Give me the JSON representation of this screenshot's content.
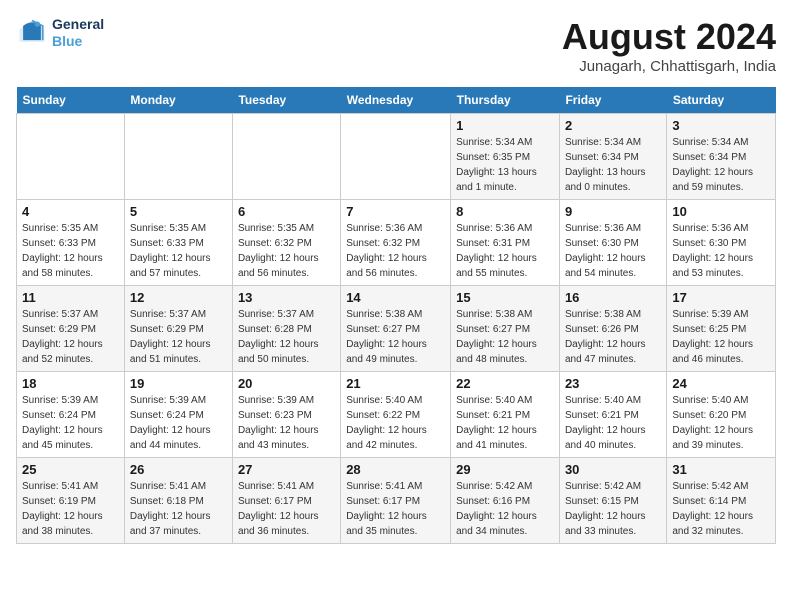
{
  "logo": {
    "line1": "General",
    "line2": "Blue"
  },
  "title": "August 2024",
  "subtitle": "Junagarh, Chhattisgarh, India",
  "days_of_week": [
    "Sunday",
    "Monday",
    "Tuesday",
    "Wednesday",
    "Thursday",
    "Friday",
    "Saturday"
  ],
  "weeks": [
    [
      {
        "day": "",
        "info": ""
      },
      {
        "day": "",
        "info": ""
      },
      {
        "day": "",
        "info": ""
      },
      {
        "day": "",
        "info": ""
      },
      {
        "day": "1",
        "info": "Sunrise: 5:34 AM\nSunset: 6:35 PM\nDaylight: 13 hours\nand 1 minute."
      },
      {
        "day": "2",
        "info": "Sunrise: 5:34 AM\nSunset: 6:34 PM\nDaylight: 13 hours\nand 0 minutes."
      },
      {
        "day": "3",
        "info": "Sunrise: 5:34 AM\nSunset: 6:34 PM\nDaylight: 12 hours\nand 59 minutes."
      }
    ],
    [
      {
        "day": "4",
        "info": "Sunrise: 5:35 AM\nSunset: 6:33 PM\nDaylight: 12 hours\nand 58 minutes."
      },
      {
        "day": "5",
        "info": "Sunrise: 5:35 AM\nSunset: 6:33 PM\nDaylight: 12 hours\nand 57 minutes."
      },
      {
        "day": "6",
        "info": "Sunrise: 5:35 AM\nSunset: 6:32 PM\nDaylight: 12 hours\nand 56 minutes."
      },
      {
        "day": "7",
        "info": "Sunrise: 5:36 AM\nSunset: 6:32 PM\nDaylight: 12 hours\nand 56 minutes."
      },
      {
        "day": "8",
        "info": "Sunrise: 5:36 AM\nSunset: 6:31 PM\nDaylight: 12 hours\nand 55 minutes."
      },
      {
        "day": "9",
        "info": "Sunrise: 5:36 AM\nSunset: 6:30 PM\nDaylight: 12 hours\nand 54 minutes."
      },
      {
        "day": "10",
        "info": "Sunrise: 5:36 AM\nSunset: 6:30 PM\nDaylight: 12 hours\nand 53 minutes."
      }
    ],
    [
      {
        "day": "11",
        "info": "Sunrise: 5:37 AM\nSunset: 6:29 PM\nDaylight: 12 hours\nand 52 minutes."
      },
      {
        "day": "12",
        "info": "Sunrise: 5:37 AM\nSunset: 6:29 PM\nDaylight: 12 hours\nand 51 minutes."
      },
      {
        "day": "13",
        "info": "Sunrise: 5:37 AM\nSunset: 6:28 PM\nDaylight: 12 hours\nand 50 minutes."
      },
      {
        "day": "14",
        "info": "Sunrise: 5:38 AM\nSunset: 6:27 PM\nDaylight: 12 hours\nand 49 minutes."
      },
      {
        "day": "15",
        "info": "Sunrise: 5:38 AM\nSunset: 6:27 PM\nDaylight: 12 hours\nand 48 minutes."
      },
      {
        "day": "16",
        "info": "Sunrise: 5:38 AM\nSunset: 6:26 PM\nDaylight: 12 hours\nand 47 minutes."
      },
      {
        "day": "17",
        "info": "Sunrise: 5:39 AM\nSunset: 6:25 PM\nDaylight: 12 hours\nand 46 minutes."
      }
    ],
    [
      {
        "day": "18",
        "info": "Sunrise: 5:39 AM\nSunset: 6:24 PM\nDaylight: 12 hours\nand 45 minutes."
      },
      {
        "day": "19",
        "info": "Sunrise: 5:39 AM\nSunset: 6:24 PM\nDaylight: 12 hours\nand 44 minutes."
      },
      {
        "day": "20",
        "info": "Sunrise: 5:39 AM\nSunset: 6:23 PM\nDaylight: 12 hours\nand 43 minutes."
      },
      {
        "day": "21",
        "info": "Sunrise: 5:40 AM\nSunset: 6:22 PM\nDaylight: 12 hours\nand 42 minutes."
      },
      {
        "day": "22",
        "info": "Sunrise: 5:40 AM\nSunset: 6:21 PM\nDaylight: 12 hours\nand 41 minutes."
      },
      {
        "day": "23",
        "info": "Sunrise: 5:40 AM\nSunset: 6:21 PM\nDaylight: 12 hours\nand 40 minutes."
      },
      {
        "day": "24",
        "info": "Sunrise: 5:40 AM\nSunset: 6:20 PM\nDaylight: 12 hours\nand 39 minutes."
      }
    ],
    [
      {
        "day": "25",
        "info": "Sunrise: 5:41 AM\nSunset: 6:19 PM\nDaylight: 12 hours\nand 38 minutes."
      },
      {
        "day": "26",
        "info": "Sunrise: 5:41 AM\nSunset: 6:18 PM\nDaylight: 12 hours\nand 37 minutes."
      },
      {
        "day": "27",
        "info": "Sunrise: 5:41 AM\nSunset: 6:17 PM\nDaylight: 12 hours\nand 36 minutes."
      },
      {
        "day": "28",
        "info": "Sunrise: 5:41 AM\nSunset: 6:17 PM\nDaylight: 12 hours\nand 35 minutes."
      },
      {
        "day": "29",
        "info": "Sunrise: 5:42 AM\nSunset: 6:16 PM\nDaylight: 12 hours\nand 34 minutes."
      },
      {
        "day": "30",
        "info": "Sunrise: 5:42 AM\nSunset: 6:15 PM\nDaylight: 12 hours\nand 33 minutes."
      },
      {
        "day": "31",
        "info": "Sunrise: 5:42 AM\nSunset: 6:14 PM\nDaylight: 12 hours\nand 32 minutes."
      }
    ]
  ]
}
